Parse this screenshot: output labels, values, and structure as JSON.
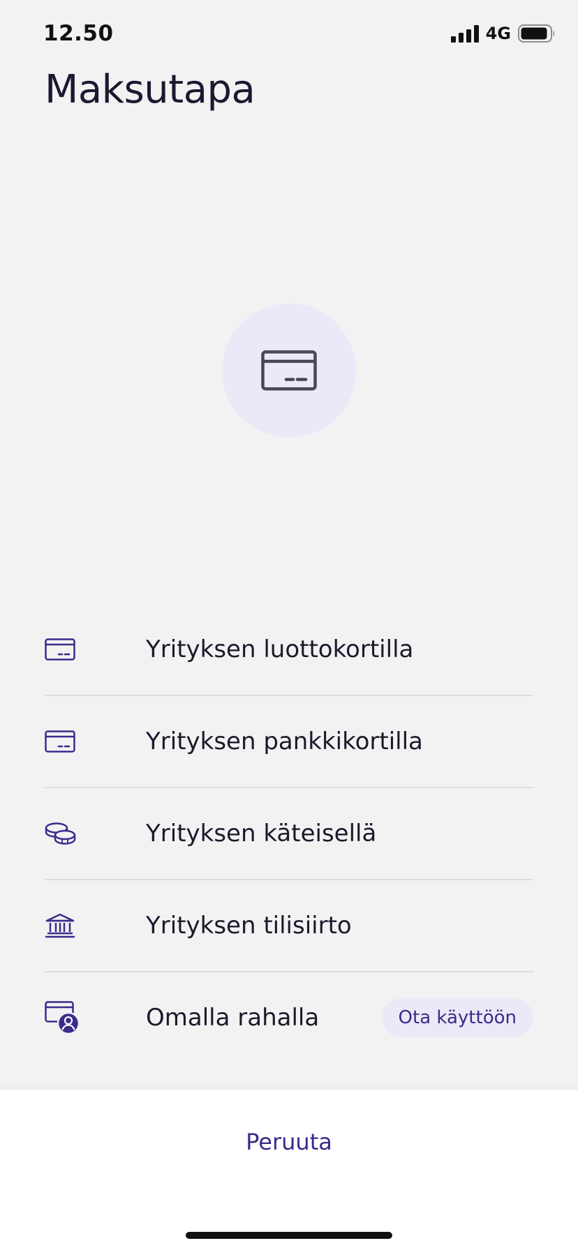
{
  "status_bar": {
    "time": "12.50",
    "network": "4G",
    "icons": [
      "signal-icon",
      "battery-icon"
    ]
  },
  "header": {
    "title": "Maksutapa"
  },
  "hero": {
    "icon": "credit-card-icon"
  },
  "options": [
    {
      "label": "Yrityksen luottokortilla",
      "icon": "credit-card-icon"
    },
    {
      "label": "Yrityksen pankkikortilla",
      "icon": "debit-card-icon"
    },
    {
      "label": "Yrityksen käteisellä",
      "icon": "coins-icon"
    },
    {
      "label": "Yrityksen tilisiirto",
      "icon": "bank-icon"
    },
    {
      "label": "Omalla rahalla",
      "icon": "personal-card-icon",
      "badge": "Ota käyttöön"
    }
  ],
  "footer": {
    "cancel_label": "Peruuta"
  },
  "colors": {
    "accent": "#3b2b8a",
    "badge_bg": "#ebe9f7",
    "background": "#f3f2f3",
    "sheet_bg": "#ffffff"
  }
}
